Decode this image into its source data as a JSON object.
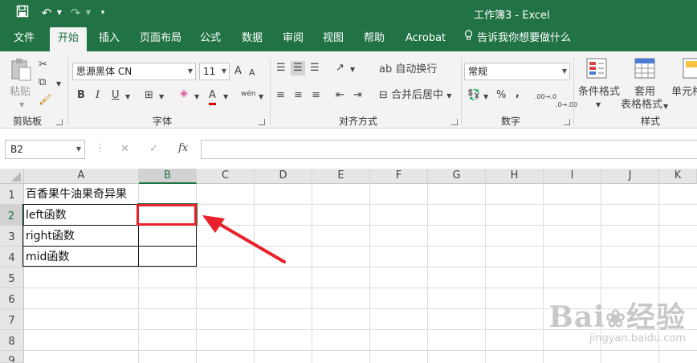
{
  "title_bar": {
    "doc_title": "工作簿3  -  Excel",
    "save_icon": "save-icon",
    "undo_icon": "undo-icon",
    "redo_icon": "redo-icon",
    "customize_icon": "customize-qat-icon"
  },
  "tabs": [
    "文件",
    "开始",
    "插入",
    "页面布局",
    "公式",
    "数据",
    "审阅",
    "视图",
    "帮助",
    "Acrobat"
  ],
  "tell_me": "告诉我你想要做什么",
  "ribbon": {
    "clipboard": {
      "paste": "粘贴",
      "label": "剪贴板"
    },
    "font": {
      "name": "思源黑体 CN",
      "size": "11",
      "bold": "B",
      "italic": "I",
      "underline": "U",
      "grow": "A",
      "shrink": "A",
      "font_color": "A",
      "phonetic": "wén",
      "label": "字体"
    },
    "alignment": {
      "wrap": "自动换行",
      "merge": "合并后居中",
      "label": "对齐方式"
    },
    "number": {
      "format": "常规",
      "percent": "%",
      "comma": ",",
      "inc_decimal": ".00→.0",
      "dec_decimal": ".0→.00",
      "label": "数字"
    },
    "styles": {
      "conditional": "条件格式",
      "table_format_1": "套用",
      "table_format_2": "表格格式",
      "cell_styles": "单元格",
      "label": "样式"
    }
  },
  "formula_bar": {
    "name_box": "B2",
    "cancel": "✕",
    "enter": "✓",
    "fx": "fx",
    "value": ""
  },
  "columns": [
    "A",
    "B",
    "C",
    "D",
    "E",
    "F",
    "G",
    "H",
    "I",
    "J",
    "K"
  ],
  "rows": [
    "1",
    "2",
    "3",
    "4",
    "5",
    "6",
    "7",
    "8",
    "9"
  ],
  "cells": {
    "A1": "百香果牛油果奇异果",
    "A2": "left函数",
    "A3": "right函数",
    "A4": "mid函数"
  },
  "watermark": {
    "brand": "Bai",
    "brand2": "经验",
    "url": "jingyan.baidu.com"
  },
  "colors": {
    "excel_green": "#217346",
    "annotation_red": "#e8212a"
  }
}
